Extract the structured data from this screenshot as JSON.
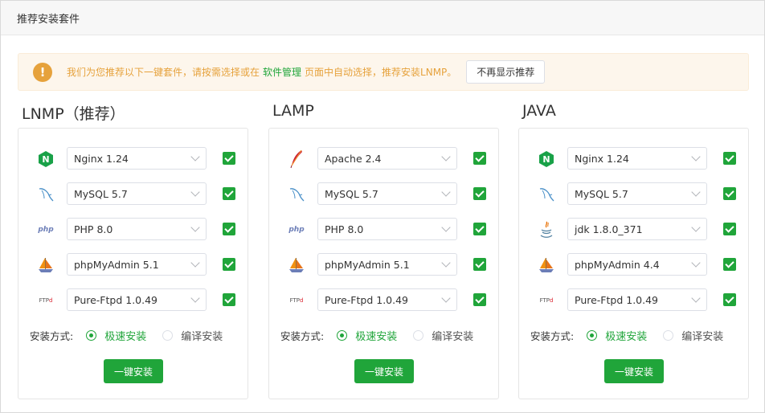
{
  "window": {
    "title": "推荐安装套件"
  },
  "notice": {
    "text_before": "我们为您推荐以下一键套件，请按需选择或在",
    "link": "软件管理",
    "text_after": "页面中自动选择，推荐安装LNMP。",
    "dismiss_label": "不再显示推荐"
  },
  "colors": {
    "accent": "#20a53a",
    "warning": "#e6a23c",
    "warning_bg": "#fdf6ec"
  },
  "labels": {
    "install_mode": "安装方式:",
    "fast": "极速安装",
    "compile": "编译安装",
    "install_button": "一键安装"
  },
  "suites": [
    {
      "title": "LNMP（推荐）",
      "items": [
        {
          "icon": "nginx-icon",
          "value": "Nginx 1.24",
          "checked": true
        },
        {
          "icon": "mysql-icon",
          "value": "MySQL 5.7",
          "checked": true
        },
        {
          "icon": "php-icon",
          "value": "PHP 8.0",
          "checked": true
        },
        {
          "icon": "phpmyadmin-icon",
          "value": "phpMyAdmin 5.1",
          "checked": true
        },
        {
          "icon": "pureftpd-icon",
          "value": "Pure-Ftpd 1.0.49",
          "checked": true
        }
      ],
      "mode": "fast"
    },
    {
      "title": "LAMP",
      "items": [
        {
          "icon": "apache-icon",
          "value": "Apache 2.4",
          "checked": true
        },
        {
          "icon": "mysql-icon",
          "value": "MySQL 5.7",
          "checked": true
        },
        {
          "icon": "php-icon",
          "value": "PHP 8.0",
          "checked": true
        },
        {
          "icon": "phpmyadmin-icon",
          "value": "phpMyAdmin 5.1",
          "checked": true
        },
        {
          "icon": "pureftpd-icon",
          "value": "Pure-Ftpd 1.0.49",
          "checked": true
        }
      ],
      "mode": "fast"
    },
    {
      "title": "JAVA",
      "items": [
        {
          "icon": "nginx-icon",
          "value": "Nginx 1.24",
          "checked": true
        },
        {
          "icon": "mysql-icon",
          "value": "MySQL 5.7",
          "checked": true
        },
        {
          "icon": "java-icon",
          "value": "jdk 1.8.0_371",
          "checked": true
        },
        {
          "icon": "phpmyadmin-icon",
          "value": "phpMyAdmin 4.4",
          "checked": true
        },
        {
          "icon": "pureftpd-icon",
          "value": "Pure-Ftpd 1.0.49",
          "checked": true
        }
      ],
      "mode": "fast"
    }
  ]
}
